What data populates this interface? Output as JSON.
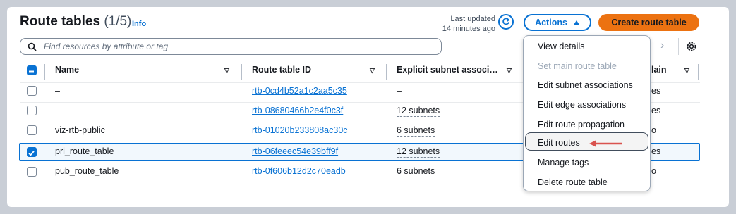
{
  "header": {
    "title": "Route tables",
    "count": "(1/5)",
    "info_label": "Info",
    "last_updated_line1": "Last updated",
    "last_updated_line2": "14 minutes ago",
    "actions_label": "Actions",
    "create_label": "Create route table"
  },
  "search": {
    "placeholder": "Find resources by attribute or tag"
  },
  "table": {
    "columns": [
      "Name",
      "Route table ID",
      "Explicit subnet associ…",
      "Main"
    ],
    "partial_main_header": "lain",
    "rows": [
      {
        "name": "–",
        "id": "rtb-0cd4b52a1c2aa5c35",
        "subnets": "–",
        "main": "es",
        "selected": false
      },
      {
        "name": "–",
        "id": "rtb-08680466b2e4f0c3f",
        "subnets": "12 subnets",
        "main": "es",
        "selected": false
      },
      {
        "name": "viz-rtb-public",
        "id": "rtb-01020b233808ac30c",
        "subnets": "6 subnets",
        "main": "o",
        "selected": false
      },
      {
        "name": "pri_route_table",
        "id": "rtb-06feeec54e39bff9f",
        "subnets": "12 subnets",
        "main": "es",
        "selected": true
      },
      {
        "name": "pub_route_table",
        "id": "rtb-0f606b12d2c70eadb",
        "subnets": "6 subnets",
        "main": "o",
        "selected": false
      }
    ]
  },
  "menu": {
    "items": [
      {
        "label": "View details",
        "disabled": false
      },
      {
        "label": "Set main route table",
        "disabled": true
      },
      {
        "label": "Edit subnet associations",
        "disabled": false
      },
      {
        "label": "Edit edge associations",
        "disabled": false
      },
      {
        "label": "Edit route propagation",
        "disabled": false
      },
      {
        "label": "Edit routes",
        "disabled": false
      },
      {
        "label": "Manage tags",
        "disabled": false
      },
      {
        "label": "Delete route table",
        "disabled": false
      }
    ]
  },
  "colors": {
    "accent": "#0972d3",
    "primary_button": "#ec7211",
    "annotation_arrow": "#d9534f"
  }
}
